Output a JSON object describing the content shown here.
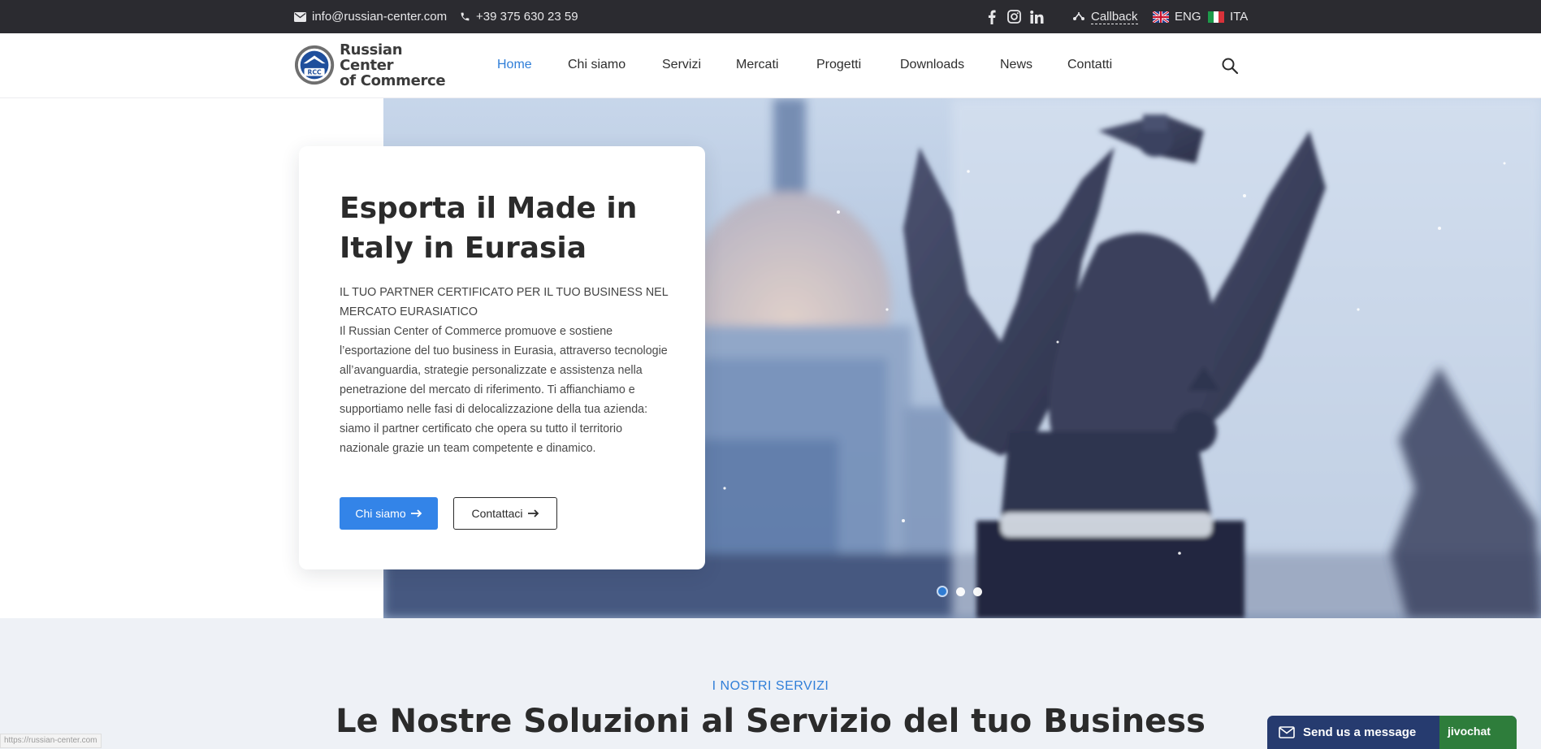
{
  "topbar": {
    "email": "info@russian-center.com",
    "phone": "+39 375 630 23 59",
    "social": [
      "facebook-icon",
      "instagram-icon",
      "linkedin-icon"
    ],
    "callback": "Callback",
    "languages": [
      {
        "code": "ENG",
        "flag": "uk-flag-icon"
      },
      {
        "code": "ITA",
        "flag": "italy-flag-icon"
      }
    ]
  },
  "header": {
    "logo_line1": "Russian Center",
    "logo_line2": "of Commerce",
    "logo_badge": "RCC",
    "nav": [
      "Home",
      "Chi siamo",
      "Servizi",
      "Mercati",
      "Progetti",
      "Downloads",
      "News",
      "Contatti"
    ],
    "active_nav": "Home",
    "search_icon": "search-icon"
  },
  "hero": {
    "title": "Esporta il Made in Italy in Eurasia",
    "subtitle": "IL TUO PARTNER CERTIFICATO PER IL TUO BUSINESS NEL MERCATO EURASIATICO",
    "body": "Il Russian Center of Commerce promuove e sostiene l’esportazione del tuo business in Eurasia, attraverso tecnologie all’avanguardia, strategie personalizzate e assistenza nella penetrazione del mercato di riferimento. Ti affianchiamo e supportiamo nelle fasi di delocalizzazione della tua azienda: siamo il partner certificato che opera su tutto il territorio nazionale grazie un team competente e dinamico.",
    "primary_button": "Chi siamo",
    "secondary_button": "Contattaci",
    "slides": 3,
    "active_slide": 1
  },
  "services": {
    "kicker": "I NOSTRI SERVIZI",
    "title": "Le Nostre Soluzioni al Servizio del tuo Business"
  },
  "status_url": "https://russian-center.com",
  "chat": {
    "label": "Send us a message",
    "brand": "jivochat"
  },
  "colors": {
    "accent": "#2f7ed8",
    "topbar": "#2b2b30",
    "button": "#3384e8",
    "chat": "#263b6f",
    "chat_brand": "#2e7d3b",
    "section_bg": "#eef1f6"
  }
}
